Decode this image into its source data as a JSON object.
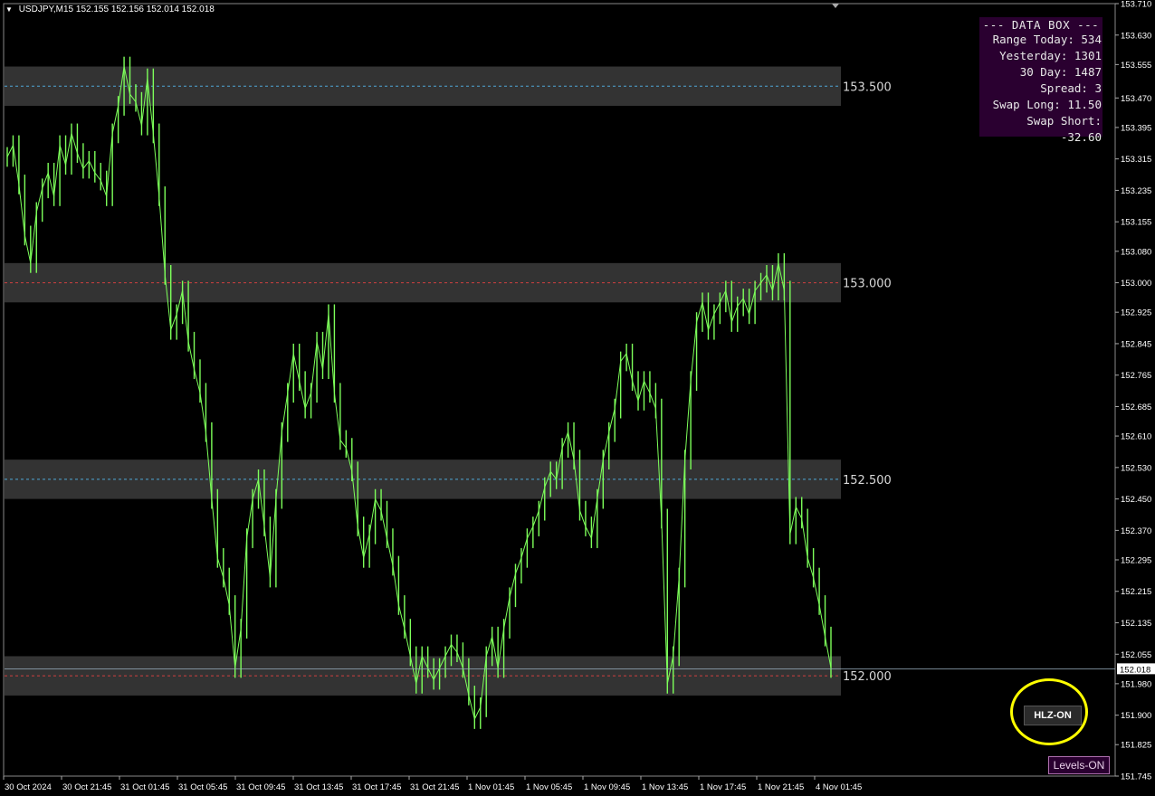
{
  "header": {
    "symbol": "USDJPY,M15",
    "ohlc": "152.155 152.156 152.014 152.018"
  },
  "data_box": {
    "title": "---  DATA  BOX  ---",
    "rows": [
      "Range Today: 534",
      "Yesterday: 1301",
      "30 Day: 1487",
      "Spread:   3",
      "Swap Long: 11.50",
      "Swap Short: -32.60"
    ]
  },
  "buttons": {
    "hlz": "HLZ-ON",
    "levels": "Levels-ON"
  },
  "colors": {
    "candle": "#7dff5a",
    "zone_fill": "#333333",
    "level_blue": "#4fa8d8",
    "level_red": "#d04040",
    "axis_text": "#ffffff",
    "highlight_ring": "#ffff00"
  },
  "chart_data": {
    "type": "line",
    "title": "USDJPY,M15",
    "ylim": [
      151.745,
      153.71
    ],
    "y_ticks": [
      "153.710",
      "153.630",
      "153.555",
      "153.470",
      "153.395",
      "153.315",
      "153.235",
      "153.155",
      "153.080",
      "153.000",
      "152.925",
      "152.845",
      "152.765",
      "152.685",
      "152.610",
      "152.530",
      "152.450",
      "152.370",
      "152.295",
      "152.215",
      "152.135",
      "152.055",
      "151.980",
      "151.900",
      "151.825",
      "151.745"
    ],
    "x_ticks": [
      "30 Oct 2024",
      "30 Oct 21:45",
      "31 Oct 01:45",
      "31 Oct 05:45",
      "31 Oct 09:45",
      "31 Oct 13:45",
      "31 Oct 17:45",
      "31 Oct 21:45",
      "1 Nov 01:45",
      "1 Nov 05:45",
      "1 Nov 09:45",
      "1 Nov 13:45",
      "1 Nov 17:45",
      "1 Nov 21:45",
      "4 Nov 01:45"
    ],
    "current_price": "152.018",
    "current_price_value": 152.018,
    "levels": [
      {
        "label": "153.500",
        "value": 153.5,
        "style": "blue"
      },
      {
        "label": "153.000",
        "value": 153.0,
        "style": "red"
      },
      {
        "label": "152.500",
        "value": 152.5,
        "style": "blue"
      },
      {
        "label": "152.000",
        "value": 152.0,
        "style": "red"
      }
    ],
    "zone_halfwidth": 0.05,
    "series": [
      {
        "values": [
          153.32,
          153.35,
          153.25,
          153.12,
          153.05,
          153.18,
          153.24,
          153.28,
          153.22,
          153.35,
          153.3,
          153.38,
          153.33,
          153.29,
          153.31,
          153.28,
          153.26,
          153.22,
          153.38,
          153.45,
          153.55,
          153.48,
          153.46,
          153.4,
          153.52,
          153.38,
          153.22,
          153.02,
          152.88,
          152.92,
          152.98,
          152.85,
          152.78,
          152.72,
          152.62,
          152.45,
          152.3,
          152.25,
          152.18,
          152.02,
          152.12,
          152.35,
          152.45,
          152.5,
          152.38,
          152.25,
          152.45,
          152.62,
          152.72,
          152.82,
          152.75,
          152.68,
          152.72,
          152.85,
          152.78,
          152.92,
          152.72,
          152.6,
          152.58,
          152.52,
          152.38,
          152.3,
          152.36,
          152.45,
          152.42,
          152.35,
          152.28,
          152.18,
          152.12,
          152.05,
          151.98,
          152.05,
          152.02,
          151.99,
          152.02,
          152.05,
          152.08,
          152.06,
          152.02,
          151.95,
          151.89,
          151.92,
          152.05,
          152.1,
          152.02,
          152.12,
          152.2,
          152.26,
          152.3,
          152.35,
          152.38,
          152.42,
          152.48,
          152.52,
          152.5,
          152.58,
          152.62,
          152.55,
          152.42,
          152.38,
          152.35,
          152.45,
          152.55,
          152.62,
          152.68,
          152.8,
          152.82,
          152.75,
          152.7,
          152.75,
          152.72,
          152.68,
          152.4,
          151.98,
          152.05,
          152.25,
          152.55,
          152.75,
          152.9,
          152.95,
          152.88,
          152.92,
          152.95,
          152.98,
          152.9,
          152.94,
          152.96,
          152.92,
          152.98,
          153.0,
          153.02,
          152.98,
          153.05,
          152.98,
          152.36,
          152.43,
          152.4,
          152.3,
          152.25,
          152.18,
          152.1,
          152.02
        ]
      }
    ]
  }
}
